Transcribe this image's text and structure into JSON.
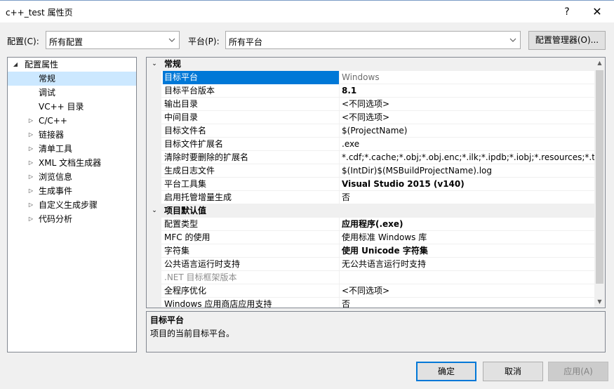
{
  "window": {
    "title": "c++_test 属性页",
    "help": "?",
    "close": "✕"
  },
  "toolbar": {
    "config_label": "配置(C):",
    "config_value": "所有配置",
    "platform_label": "平台(P):",
    "platform_value": "所有平台",
    "manager_button": "配置管理器(O)..."
  },
  "tree": {
    "root": "配置属性",
    "items": [
      {
        "label": "常规",
        "expandable": false,
        "selected": true
      },
      {
        "label": "调试",
        "expandable": false
      },
      {
        "label": "VC++ 目录",
        "expandable": false
      },
      {
        "label": "C/C++",
        "expandable": true
      },
      {
        "label": "链接器",
        "expandable": true
      },
      {
        "label": "清单工具",
        "expandable": true
      },
      {
        "label": "XML 文档生成器",
        "expandable": true
      },
      {
        "label": "浏览信息",
        "expandable": true
      },
      {
        "label": "生成事件",
        "expandable": true
      },
      {
        "label": "自定义生成步骤",
        "expandable": true
      },
      {
        "label": "代码分析",
        "expandable": true
      }
    ]
  },
  "grid": {
    "sections": [
      {
        "title": "常规",
        "rows": [
          {
            "name": "目标平台",
            "value": "Windows",
            "selected": true
          },
          {
            "name": "目标平台版本",
            "value": "8.1",
            "bold": true
          },
          {
            "name": "输出目录",
            "value": "<不同选项>"
          },
          {
            "name": "中间目录",
            "value": "<不同选项>"
          },
          {
            "name": "目标文件名",
            "value": "$(ProjectName)"
          },
          {
            "name": "目标文件扩展名",
            "value": ".exe"
          },
          {
            "name": "清除时要删除的扩展名",
            "value": "*.cdf;*.cache;*.obj;*.obj.enc;*.ilk;*.ipdb;*.iobj;*.resources;*.tlb;*.tli"
          },
          {
            "name": "生成日志文件",
            "value": "$(IntDir)$(MSBuildProjectName).log"
          },
          {
            "name": "平台工具集",
            "value": "Visual Studio 2015 (v140)",
            "bold": true
          },
          {
            "name": "启用托管增量生成",
            "value": "否"
          }
        ]
      },
      {
        "title": "项目默认值",
        "rows": [
          {
            "name": "配置类型",
            "value": "应用程序(.exe)",
            "bold": true
          },
          {
            "name": "MFC 的使用",
            "value": "使用标准 Windows 库"
          },
          {
            "name": "字符集",
            "value": "使用 Unicode 字符集",
            "bold": true
          },
          {
            "name": "公共语言运行时支持",
            "value": "无公共语言运行时支持"
          },
          {
            "name": ".NET 目标框架版本",
            "value": "",
            "disabled": true
          },
          {
            "name": "全程序优化",
            "value": "<不同选项>"
          },
          {
            "name": "Windows 应用商店应用支持",
            "value": "否"
          }
        ]
      }
    ]
  },
  "description": {
    "title": "目标平台",
    "text": "项目的当前目标平台。"
  },
  "buttons": {
    "ok": "确定",
    "cancel": "取消",
    "apply": "应用(A)"
  }
}
